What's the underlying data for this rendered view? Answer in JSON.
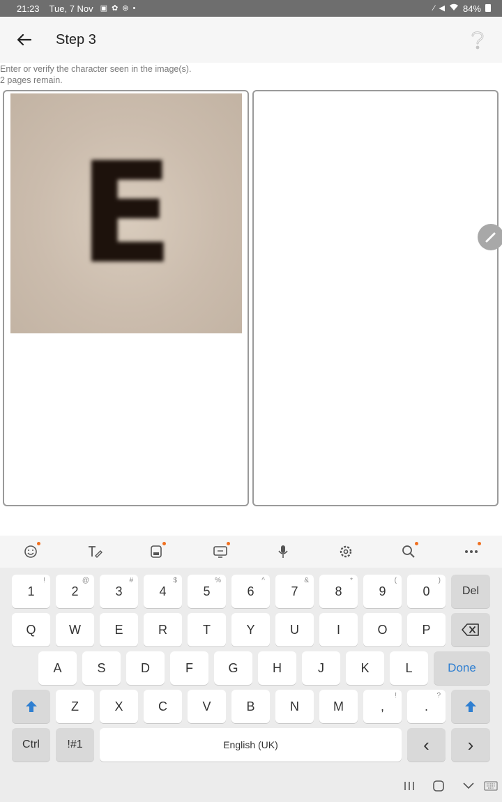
{
  "status_bar": {
    "time": "21:23",
    "date": "Tue, 7 Nov",
    "battery": "84%",
    "left_icons": [
      "gallery-icon",
      "settings-icon",
      "sync-icon",
      "dot-icon"
    ],
    "right_icons": [
      "pen-icon",
      "mute-icon",
      "wifi-icon",
      "battery-icon"
    ]
  },
  "app_bar": {
    "title": "Step 3",
    "back_icon": "arrow-left-icon",
    "help_icon": "question-icon"
  },
  "instructions": {
    "line1": "Enter or verify the character seen in the image(s).",
    "line2": "2 pages remain."
  },
  "image_panel": {
    "character": "E"
  },
  "keyboard": {
    "toolbar_icons": [
      "emoji-icon",
      "handwriting-icon",
      "sticker-icon",
      "gif-icon",
      "mic-icon",
      "settings-icon",
      "search-icon",
      "more-icon"
    ],
    "number_row": [
      {
        "label": "1",
        "hint": "!"
      },
      {
        "label": "2",
        "hint": "@"
      },
      {
        "label": "3",
        "hint": "#"
      },
      {
        "label": "4",
        "hint": "$"
      },
      {
        "label": "5",
        "hint": "%"
      },
      {
        "label": "6",
        "hint": "^"
      },
      {
        "label": "7",
        "hint": "&"
      },
      {
        "label": "8",
        "hint": "*"
      },
      {
        "label": "9",
        "hint": "("
      },
      {
        "label": "0",
        "hint": ")"
      }
    ],
    "del_label": "Del",
    "row_q": [
      "Q",
      "W",
      "E",
      "R",
      "T",
      "Y",
      "U",
      "I",
      "O",
      "P"
    ],
    "row_a": [
      "A",
      "S",
      "D",
      "F",
      "G",
      "H",
      "J",
      "K",
      "L"
    ],
    "done_label": "Done",
    "row_z": [
      "Z",
      "X",
      "C",
      "V",
      "B",
      "N",
      "M"
    ],
    "comma": {
      "label": ",",
      "hint": "!"
    },
    "period": {
      "label": ".",
      "hint": "?"
    },
    "ctrl_label": "Ctrl",
    "symbols_label": "!#1",
    "space_label": "English (UK)",
    "left_arrow": "‹",
    "right_arrow": "›",
    "accent_color": "#2f7fd1"
  }
}
